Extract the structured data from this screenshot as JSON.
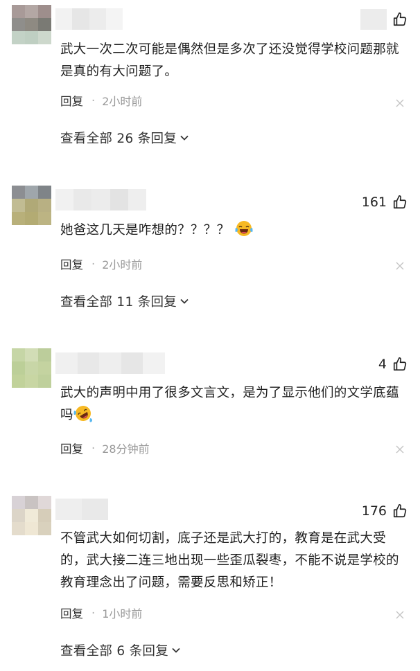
{
  "comments": [
    {
      "likes": "",
      "text": "武大一次二次可能是偶然但是多次了还没觉得学校问题那就是真的有大问题了。",
      "reply_label": "回复",
      "separator": "·",
      "time": "2小时前",
      "view_all": "查看全部 26 条回复",
      "avatar_colors": [
        "#a89a98",
        "#b3a7a4",
        "#9e8e8c",
        "#8f8e8b",
        "#8e8a82",
        "#7a7a74",
        "#c3d2c6",
        "#bfcfc2",
        "#cdd8cc"
      ],
      "name_colors": [
        "#f2f2f2",
        "#e6e6e6",
        "#ececec",
        "#f4f4f4"
      ]
    },
    {
      "likes": "161",
      "text": "她爸这几天是咋想的？？？？",
      "emoji": "laughing-tears-emoji",
      "reply_label": "回复",
      "separator": "·",
      "time": "2小时前",
      "view_all": "查看全部 11 条回复",
      "avatar_colors": [
        "#8c8e92",
        "#9fa6ab",
        "#7f8488",
        "#c1bc93",
        "#b0a977",
        "#b8b083",
        "#b8b07a",
        "#b3ab73",
        "#bcb483"
      ],
      "name_colors": [
        "#f1f1f1",
        "#e9e9e9",
        "#ececec",
        "#e3e3e3",
        "#eeeeee"
      ]
    },
    {
      "likes": "4",
      "text": "武大的声明中用了很多文言文，是为了显示他们的文学底蕴吗",
      "emoji": "rolling-laughing-emoji",
      "reply_label": "回复",
      "separator": "·",
      "time": "28分钟前",
      "view_all": "",
      "avatar_colors": [
        "#c6d6a6",
        "#d2ddb6",
        "#bccd9b",
        "#bccf98",
        "#c8d6a7",
        "#c4d3a0",
        "#c1d29a",
        "#c8d6a3",
        "#bfd09c"
      ],
      "name_colors": [
        "#f0f0f0",
        "#e8e8e8",
        "#eeeeee",
        "#e6e6e6",
        "#f2f2f2"
      ]
    },
    {
      "likes": "176",
      "text": "不管武大如何切割，底子还是武大打的，教育是在武大受的，武大接二连三地出现一些歪瓜裂枣，不能不说是学校的教育理念出了问题，需要反思和矫正！",
      "reply_label": "回复",
      "separator": "·",
      "time": "1小时前",
      "view_all": "查看全部 6 条回复",
      "avatar_colors": [
        "#d8d2d6",
        "#c9c3c2",
        "#e0d8d8",
        "#dcd5c8",
        "#f0ead8",
        "#d6cdb9",
        "#e4dccc",
        "#efe7d4",
        "#d9d1bd"
      ],
      "name_colors": [
        "#eeeeee",
        "#e9e9e9"
      ]
    }
  ],
  "icons": {
    "like": "thumbs-up-outline-icon",
    "close": "close-x-icon",
    "expand": "chevron-down-icon"
  }
}
